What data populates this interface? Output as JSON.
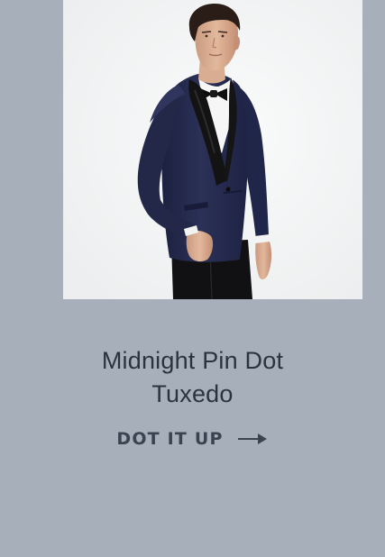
{
  "product": {
    "title_line1": "Midnight Pin Dot",
    "title_line2": "Tuxedo",
    "image_alt": "Model wearing the Midnight Pin Dot Tuxedo"
  },
  "cta": {
    "label": "DOT IT UP",
    "icon": "arrow-right-icon"
  },
  "colors": {
    "background": "#a7b0ba",
    "image_background": "#f4f5f6",
    "title_text": "#2a3340",
    "cta_text": "#3a4350",
    "jacket": "#262c4f",
    "lapel": "#121212"
  }
}
